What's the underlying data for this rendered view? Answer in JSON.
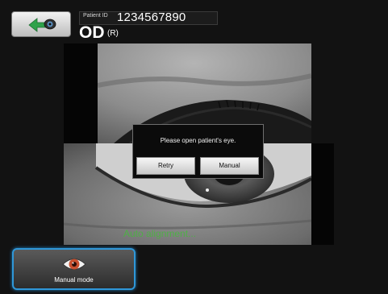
{
  "header": {
    "back_icon": "back-arrow-eye-icon",
    "patient_id_label": "Patient ID",
    "patient_id_value": "1234567890",
    "eye_side": "OD",
    "eye_side_sub": "(R)"
  },
  "camera": {
    "status_text": "Auto alignment..."
  },
  "dialog": {
    "message": "Please open patient's eye.",
    "retry_label": "Retry",
    "manual_label": "Manual"
  },
  "footer": {
    "manual_mode_icon": "eye-icon",
    "manual_mode_label": "Manual mode",
    "accent_color": "#2f97d8"
  }
}
